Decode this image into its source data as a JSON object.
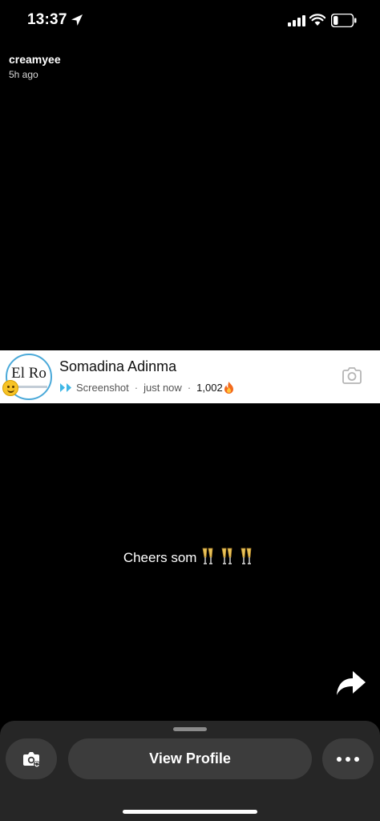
{
  "status_bar": {
    "time": "13:37",
    "battery_level": 0.25
  },
  "story": {
    "username": "creamyee",
    "posted": "5h ago"
  },
  "notification": {
    "avatar_text": "El Ro",
    "name": "Somadina Adinma",
    "type": "Screenshot",
    "when": "just now",
    "separator": "·",
    "streak_count": "1,002",
    "accent_color": "#3fb7e6"
  },
  "caption": {
    "text": "Cheers som",
    "emoji": [
      "champagne-glasses",
      "champagne-glasses",
      "champagne-glasses"
    ]
  },
  "actions": {
    "view_profile_label": "View Profile"
  }
}
